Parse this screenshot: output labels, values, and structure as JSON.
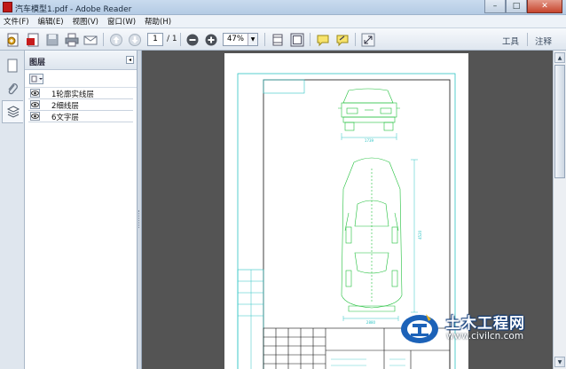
{
  "window": {
    "title": "汽车模型1.pdf - Adobe Reader",
    "minimize": "–",
    "maximize": "□",
    "close": "✕"
  },
  "menu": [
    "文件(F)",
    "编辑(E)",
    "视图(V)",
    "窗口(W)",
    "帮助(H)"
  ],
  "toolbar": {
    "page_current": "1",
    "page_total": "/ 1",
    "zoom": "47%",
    "tools_label": "工具",
    "comment_label": "注释"
  },
  "layers_panel": {
    "title": "图层",
    "layers": [
      {
        "name": "1轮廓实线层"
      },
      {
        "name": "2细线层"
      },
      {
        "name": "6文字层"
      }
    ]
  },
  "drawing": {
    "dims": [
      "1739",
      "4520",
      "2880"
    ]
  },
  "watermark": {
    "brand": "土木工程网",
    "url": "www.civilcn.com"
  },
  "colors": {
    "doc_background": "#545454",
    "cad_green": "#1fbf3a",
    "cad_cyan": "#2ec4c4",
    "watermark_blue": "#1c62b8"
  }
}
